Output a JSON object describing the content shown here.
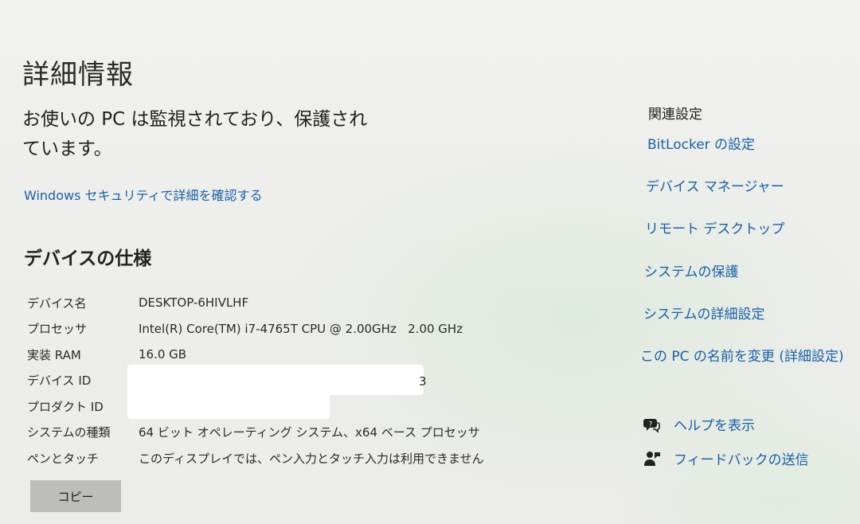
{
  "page": {
    "title": "詳細情報",
    "protection_message": "お使いの PC は監視されており、保護されています。",
    "security_link": "Windows セキュリティで詳細を確認する"
  },
  "device_specs": {
    "title": "デバイスの仕様",
    "rows": [
      {
        "label": "デバイス名",
        "value": "DESKTOP-6HIVLHF"
      },
      {
        "label": "プロセッサ",
        "value": "Intel(R) Core(TM) i7-4765T CPU @ 2.00GHz   2.00 GHz"
      },
      {
        "label": "実装 RAM",
        "value": "16.0 GB"
      },
      {
        "label": "デバイス ID",
        "value": ""
      },
      {
        "label": "プロダクト ID",
        "value": ""
      },
      {
        "label": "システムの種類",
        "value": "64 ビット オペレーティング システム、x64 ベース プロセッサ"
      },
      {
        "label": "ペンとタッチ",
        "value": "このディスプレイでは、ペン入力とタッチ入力は利用できません"
      }
    ],
    "device_id_tail": "3",
    "copy_label": "コピー"
  },
  "related_settings": {
    "title": "関連設定",
    "links": [
      "BitLocker の設定",
      "デバイス マネージャー",
      "リモート デスクトップ",
      "システムの保護",
      "システムの詳細設定",
      "この PC の名前を変更 (詳細設定)"
    ]
  },
  "help": {
    "show_help": {
      "label": "ヘルプを表示",
      "icon": "help-icon"
    },
    "feedback": {
      "label": "フィードバックの送信",
      "icon": "feedback-icon"
    }
  },
  "colors": {
    "link": "#1a5fa8",
    "background": "#eeeeec",
    "button": "#bdbdbb"
  }
}
